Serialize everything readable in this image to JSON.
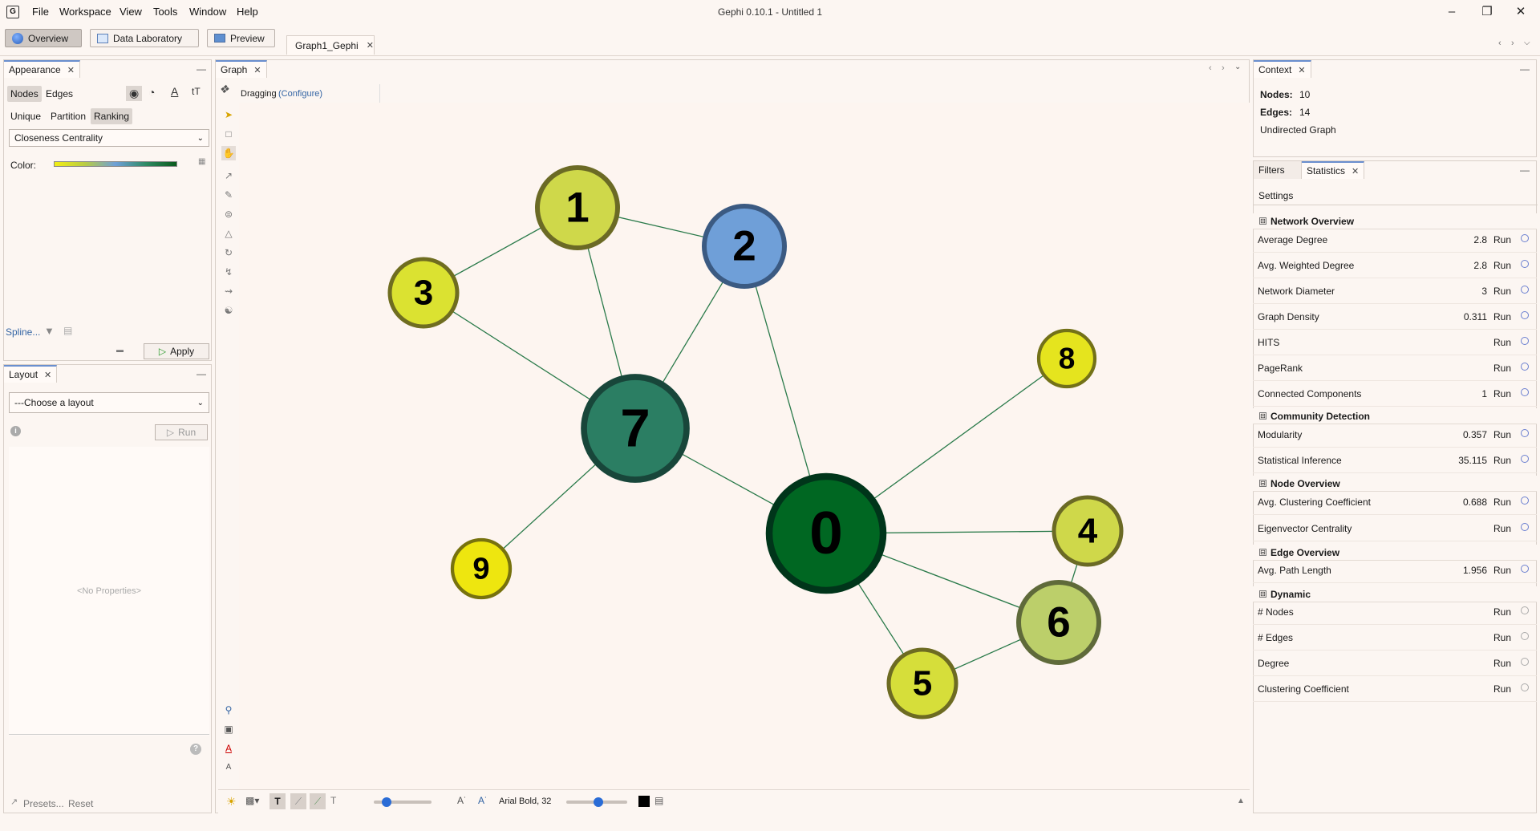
{
  "window": {
    "title": "Gephi 0.10.1 - Untitled 1",
    "menu": [
      "File",
      "Workspace",
      "View",
      "Tools",
      "Window",
      "Help"
    ]
  },
  "toolbar": {
    "overview": "Overview",
    "data_laboratory": "Data Laboratory",
    "preview": "Preview",
    "doc_tab": "Graph1_Gephi"
  },
  "appearance": {
    "title": "Appearance",
    "nodes_tab": "Nodes",
    "edges_tab": "Edges",
    "unique": "Unique",
    "partition": "Partition",
    "ranking": "Ranking",
    "attribute": "Closeness Centrality",
    "color_label": "Color:",
    "spline_label": "Spline...",
    "apply": "Apply"
  },
  "layout_panel": {
    "title": "Layout",
    "choose": "---Choose a layout",
    "run": "Run",
    "no_properties": "<No Properties>",
    "presets": "Presets...",
    "reset": "Reset"
  },
  "graph_panel": {
    "title": "Graph",
    "mode": "Dragging",
    "configure": "(Configure)",
    "font_label": "Arial Bold, 32"
  },
  "context": {
    "title": "Context",
    "nodes_label": "Nodes:",
    "nodes_value": "10",
    "edges_label": "Edges:",
    "edges_value": "14",
    "graph_type": "Undirected Graph"
  },
  "statistics": {
    "filters_tab": "Filters",
    "statistics_tab": "Statistics",
    "settings": "Settings",
    "run_label": "Run",
    "sections": [
      {
        "title": "Network Overview",
        "rows": [
          {
            "name": "Average Degree",
            "value": "2.8"
          },
          {
            "name": "Avg. Weighted Degree",
            "value": "2.8"
          },
          {
            "name": "Network Diameter",
            "value": "3"
          },
          {
            "name": "Graph Density",
            "value": "0.311"
          },
          {
            "name": "HITS",
            "value": ""
          },
          {
            "name": "PageRank",
            "value": ""
          },
          {
            "name": "Connected Components",
            "value": "1"
          }
        ]
      },
      {
        "title": "Community Detection",
        "rows": [
          {
            "name": "Modularity",
            "value": "0.357"
          },
          {
            "name": "Statistical Inference",
            "value": "35.115"
          }
        ]
      },
      {
        "title": "Node Overview",
        "rows": [
          {
            "name": "Avg. Clustering Coefficient",
            "value": "0.688"
          },
          {
            "name": "Eigenvector Centrality",
            "value": ""
          }
        ]
      },
      {
        "title": "Edge Overview",
        "rows": [
          {
            "name": "Avg. Path Length",
            "value": "1.956"
          }
        ]
      },
      {
        "title": "Dynamic",
        "rows": [
          {
            "name": "# Nodes",
            "value": ""
          },
          {
            "name": "# Edges",
            "value": ""
          },
          {
            "name": "Degree",
            "value": ""
          },
          {
            "name": "Clustering Coefficient",
            "value": ""
          }
        ]
      }
    ]
  },
  "graph": {
    "nodes": [
      {
        "id": "0",
        "fill": "#006722",
        "stroke": "#00351a"
      },
      {
        "id": "1",
        "fill": "#cfd84a",
        "stroke": "#6b6a25"
      },
      {
        "id": "2",
        "fill": "#6f9fd8",
        "stroke": "#3b5a82"
      },
      {
        "id": "3",
        "fill": "#dbe231",
        "stroke": "#6f6d20"
      },
      {
        "id": "4",
        "fill": "#cfd84a",
        "stroke": "#6b6a25"
      },
      {
        "id": "5",
        "fill": "#d6de3a",
        "stroke": "#6d6b22"
      },
      {
        "id": "6",
        "fill": "#bccf6a",
        "stroke": "#5f6a3a"
      },
      {
        "id": "7",
        "fill": "#2b7e63",
        "stroke": "#18463a"
      },
      {
        "id": "8",
        "fill": "#e5e41e",
        "stroke": "#737118"
      },
      {
        "id": "9",
        "fill": "#eee60f",
        "stroke": "#77720e"
      }
    ],
    "edges": [
      [
        "1",
        "3"
      ],
      [
        "1",
        "2"
      ],
      [
        "1",
        "7"
      ],
      [
        "3",
        "7"
      ],
      [
        "2",
        "7"
      ],
      [
        "2",
        "0"
      ],
      [
        "7",
        "0"
      ],
      [
        "7",
        "9"
      ],
      [
        "0",
        "8"
      ],
      [
        "0",
        "4"
      ],
      [
        "0",
        "6"
      ],
      [
        "0",
        "5"
      ],
      [
        "4",
        "6"
      ],
      [
        "6",
        "5"
      ]
    ],
    "edge_color": "#2a7a4a"
  }
}
